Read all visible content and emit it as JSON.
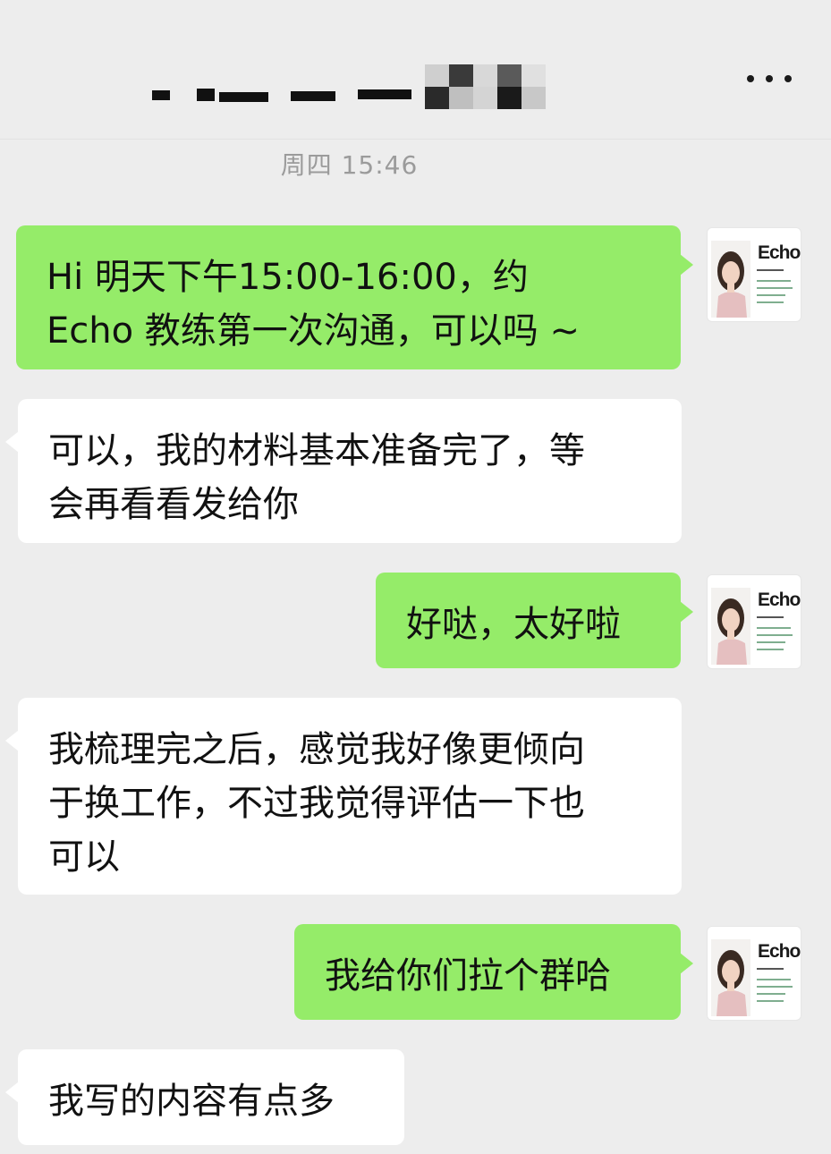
{
  "header": {
    "more_icon": "more-dots-icon"
  },
  "timestamp": "周四 15:46",
  "colors": {
    "background": "#ededed",
    "sent_bubble": "#95ec69",
    "received_bubble": "#ffffff",
    "timestamp_text": "#9b9b9b"
  },
  "avatar": {
    "brand": "Echo"
  },
  "messages": [
    {
      "side": "sent",
      "lines": [
        "Hi  明天下午15:00-16:00，约",
        "Echo 教练第一次沟通，可以吗 ~"
      ]
    },
    {
      "side": "received",
      "lines": [
        "可以，我的材料基本准备完了，等",
        "会再看看发给你"
      ]
    },
    {
      "side": "sent",
      "lines": [
        "好哒，太好啦"
      ]
    },
    {
      "side": "received",
      "lines": [
        "我梳理完之后，感觉我好像更倾向",
        "于换工作，不过我觉得评估一下也",
        "可以"
      ]
    },
    {
      "side": "sent",
      "lines": [
        "我给你们拉个群哈"
      ]
    },
    {
      "side": "received",
      "lines": [
        "我写的内容有点多"
      ]
    }
  ]
}
